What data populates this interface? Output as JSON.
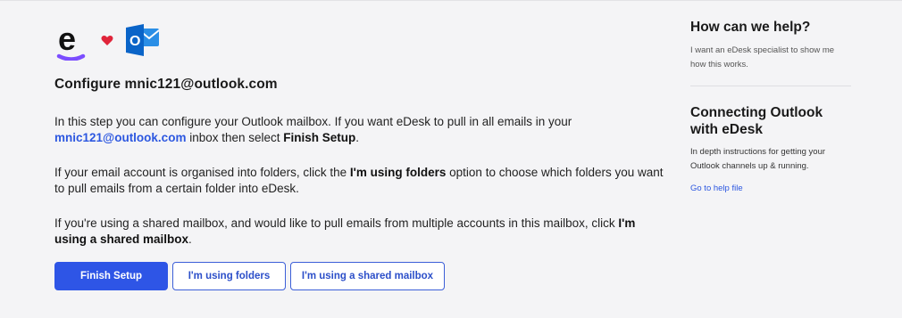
{
  "header": {
    "edesk_logo_letter": "e",
    "outlook_logo_letter": "O"
  },
  "main": {
    "title_prefix": "Configure ",
    "title_email": "mnic121@outlook.com",
    "p1": {
      "text_a": "In this step you can configure your Outlook mailbox. If you want eDesk to pull in all emails in your ",
      "email": "mnic121@outlook.com",
      "text_b": " inbox then select ",
      "bold": "Finish Setup",
      "text_c": "."
    },
    "p2": {
      "text_a": "If your email account is organised into folders, click the ",
      "bold": "I'm using folders",
      "text_b": " option to choose which folders you want to pull emails from a certain folder into eDesk."
    },
    "p3": {
      "text_a": "If you're using a shared mailbox, and would like to pull emails from multiple accounts in this mailbox, click ",
      "bold": "I'm using a shared mailbox",
      "text_b": "."
    },
    "buttons": {
      "finish": "Finish Setup",
      "folders": "I'm using folders",
      "shared": "I'm using a shared mailbox"
    }
  },
  "sidebar": {
    "help_title": "How can we help?",
    "help_text": "I want an eDesk specialist to show me how this works.",
    "connect_title": "Connecting Outlook with eDesk",
    "connect_text": "In depth instructions for getting your Outlook channels up & running.",
    "help_link": "Go to help file"
  },
  "colors": {
    "accent": "#2e55e6",
    "link": "#2c57e0",
    "edesk_underline": "#7b4dff",
    "heart": "#e0243a",
    "outlook_blue": "#0a64c8"
  },
  "icons": [
    "edesk-logo",
    "heart-icon",
    "outlook-logo"
  ]
}
